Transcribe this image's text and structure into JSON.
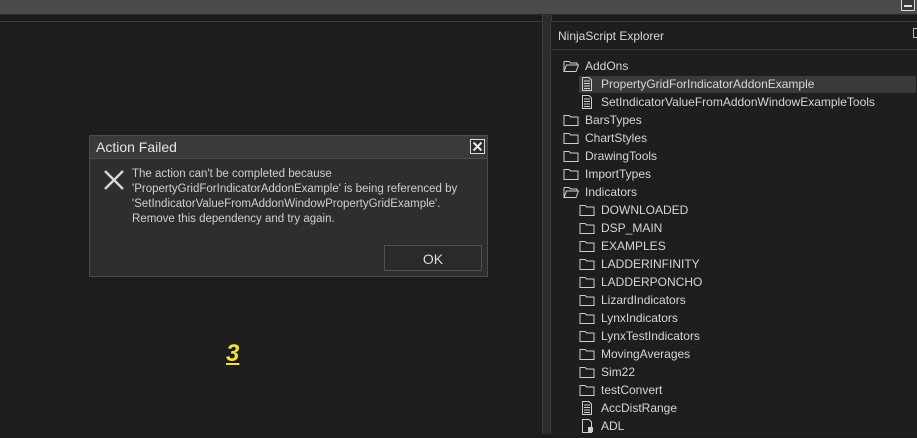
{
  "window": {
    "minimize_icon": "minimize-icon"
  },
  "explorer": {
    "title": "NinjaScript Explorer",
    "items": [
      {
        "label": "AddOns",
        "icon": "folder-open-icon",
        "level": 0
      },
      {
        "label": "PropertyGridForIndicatorAddonExample",
        "icon": "file-icon",
        "level": 1,
        "selected": true
      },
      {
        "label": "SetIndicatorValueFromAddonWindowExampleTools",
        "icon": "file-icon",
        "level": 1
      },
      {
        "label": "BarsTypes",
        "icon": "folder-icon",
        "level": 0
      },
      {
        "label": "ChartStyles",
        "icon": "folder-icon",
        "level": 0
      },
      {
        "label": "DrawingTools",
        "icon": "folder-icon",
        "level": 0
      },
      {
        "label": "ImportTypes",
        "icon": "folder-icon",
        "level": 0
      },
      {
        "label": "Indicators",
        "icon": "folder-open-icon",
        "level": 0
      },
      {
        "label": "DOWNLOADED",
        "icon": "folder-icon",
        "level": 1
      },
      {
        "label": "DSP_MAIN",
        "icon": "folder-icon",
        "level": 1
      },
      {
        "label": "EXAMPLES",
        "icon": "folder-icon",
        "level": 1
      },
      {
        "label": "LADDERINFINITY",
        "icon": "folder-icon",
        "level": 1
      },
      {
        "label": "LADDERPONCHO",
        "icon": "folder-icon",
        "level": 1
      },
      {
        "label": "LizardIndicators",
        "icon": "folder-icon",
        "level": 1
      },
      {
        "label": "LynxIndicators",
        "icon": "folder-icon",
        "level": 1
      },
      {
        "label": "LynxTestIndicators",
        "icon": "folder-icon",
        "level": 1
      },
      {
        "label": "MovingAverages",
        "icon": "folder-icon",
        "level": 1
      },
      {
        "label": "Sim22",
        "icon": "folder-icon",
        "level": 1
      },
      {
        "label": "testConvert",
        "icon": "folder-icon",
        "level": 1
      },
      {
        "label": "AccDistRange",
        "icon": "file-icon",
        "level": 1
      },
      {
        "label": "ADL",
        "icon": "locked-file-icon",
        "level": 1
      }
    ]
  },
  "dialog": {
    "title": "Action Failed",
    "icon": "error-x-icon",
    "message_lines": [
      "The action can't be completed because",
      "'PropertyGridForIndicatorAddonExample' is being referenced by",
      "'SetIndicatorValueFromAddonWindowPropertyGridExample'.",
      "Remove this dependency and try again."
    ],
    "ok_label": "OK"
  },
  "annotation": {
    "text": "3",
    "color": "#f0e040"
  },
  "colors": {
    "background": "#1c1c1c",
    "panel": "#1e1e1e",
    "dialog": "#2e2e2e",
    "selected": "#3a3a3a"
  }
}
